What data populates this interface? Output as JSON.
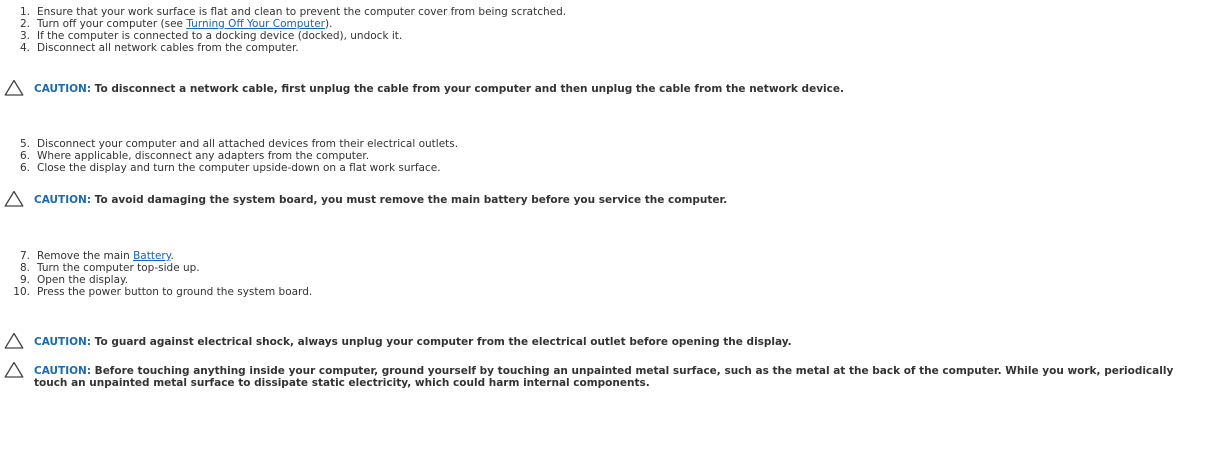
{
  "steps_group_1": [
    {
      "num": "1.",
      "text": "Ensure that your work surface is flat and clean to prevent the computer cover from being scratched."
    },
    {
      "num": "2.",
      "pre": "Turn off your computer (see ",
      "link": "Turning Off Your Computer",
      "post": ")."
    },
    {
      "num": "3.",
      "text": "If the computer is connected to a docking device (docked), undock it."
    },
    {
      "num": "4.",
      "text": "Disconnect all network cables from the computer."
    }
  ],
  "caution_1": {
    "label": "CAUTION:",
    "text": " To disconnect a network cable, first unplug the cable from your computer and then unplug the cable from the network device."
  },
  "steps_group_2": [
    {
      "num": "5.",
      "text": "Disconnect your computer and all attached devices from their electrical outlets."
    },
    {
      "num": "6.",
      "text": "Where applicable, disconnect any adapters from the computer."
    },
    {
      "num": "6.",
      "text": "Close the display and turn the computer upside-down on a flat work surface."
    }
  ],
  "caution_2": {
    "label": "CAUTION:",
    "text": " To avoid damaging the system board, you must remove the main battery before you service the computer."
  },
  "steps_group_3": [
    {
      "num": "7.",
      "pre": "Remove the main ",
      "link": "Battery",
      "post": "."
    },
    {
      "num": "8.",
      "text": "Turn the computer top-side up."
    },
    {
      "num": "9.",
      "text": "Open the display."
    },
    {
      "num": "10.",
      "text": "Press the power button to ground the system board."
    }
  ],
  "caution_3": {
    "label": "CAUTION:",
    "text": " To guard against electrical shock, always unplug your computer from the electrical outlet before opening the display."
  },
  "caution_4": {
    "label": "CAUTION:",
    "text": " Before touching anything inside your computer, ground yourself by touching an unpainted metal surface, such as the metal at the back of the computer. While you work, periodically touch an unpainted metal surface to dissipate static electricity, which could harm internal components."
  },
  "colors": {
    "text": "#333333",
    "link": "#1166bb",
    "caution_label": "#1a6ab0"
  },
  "icons": {
    "caution": "caution-triangle-icon"
  }
}
